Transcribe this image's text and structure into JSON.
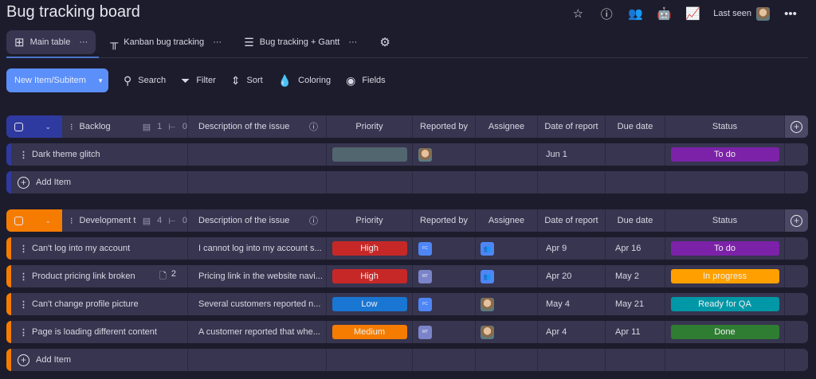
{
  "header": {
    "title": "Bug tracking board",
    "last_seen": "Last seen"
  },
  "tabs": [
    {
      "label": "Main table",
      "more": "···"
    },
    {
      "label": "Kanban bug tracking",
      "more": "···"
    },
    {
      "label": "Bug tracking + Gantt",
      "more": "···"
    }
  ],
  "toolbar": {
    "new_item": "New Item/Subitem",
    "search": "Search",
    "filter": "Filter",
    "sort": "Sort",
    "coloring": "Coloring",
    "fields": "Fields"
  },
  "columns": {
    "description": "Description of the issue",
    "priority": "Priority",
    "reported_by": "Reported by",
    "assignee": "Assignee",
    "date_of_report": "Date of report",
    "due_date": "Due date",
    "status": "Status"
  },
  "groups": [
    {
      "name": "Backlog",
      "color": "#2f3aa0",
      "items_count": "1",
      "subitems_count": "0",
      "add_item": "Add Item",
      "rows": [
        {
          "name": "Dark theme glitch",
          "description": "",
          "priority": "",
          "priority_color": "#51666f",
          "reporter": "avatar",
          "assignee": "",
          "date": "Jun 1",
          "due": "",
          "status": "To do",
          "status_color": "#7b22a8"
        }
      ]
    },
    {
      "name": "Development t...",
      "color": "#f57c00",
      "items_count": "4",
      "subitems_count": "0",
      "add_item": "Add Item",
      "rows": [
        {
          "name": "Can't log into my account",
          "description": "I cannot log into my account s...",
          "priority": "High",
          "priority_color": "#c62828",
          "reporter": "FC",
          "assignee": "group",
          "date": "Apr 9",
          "due": "Apr 16",
          "status": "To do",
          "status_color": "#7b22a8"
        },
        {
          "name": "Product pricing link broken",
          "files": "2",
          "description": "Pricing link in the website navi...",
          "priority": "High",
          "priority_color": "#c62828",
          "reporter": "MT",
          "assignee": "group",
          "date": "Apr 20",
          "due": "May 2",
          "status": "In progress",
          "status_color": "#ffa000"
        },
        {
          "name": "Can't change profile picture",
          "description": "Several customers reported n...",
          "priority": "Low",
          "priority_color": "#1976d2",
          "reporter": "FC",
          "assignee": "avatar",
          "date": "May 4",
          "due": "May 21",
          "status": "Ready for QA",
          "status_color": "#0097a7"
        },
        {
          "name": "Page is loading different content",
          "description": "A customer reported that whe...",
          "priority": "Medium",
          "priority_color": "#f57c00",
          "reporter": "MT",
          "assignee": "avatar",
          "date": "Apr 4",
          "due": "Apr 11",
          "status": "Done",
          "status_color": "#2e7d32"
        }
      ]
    }
  ]
}
